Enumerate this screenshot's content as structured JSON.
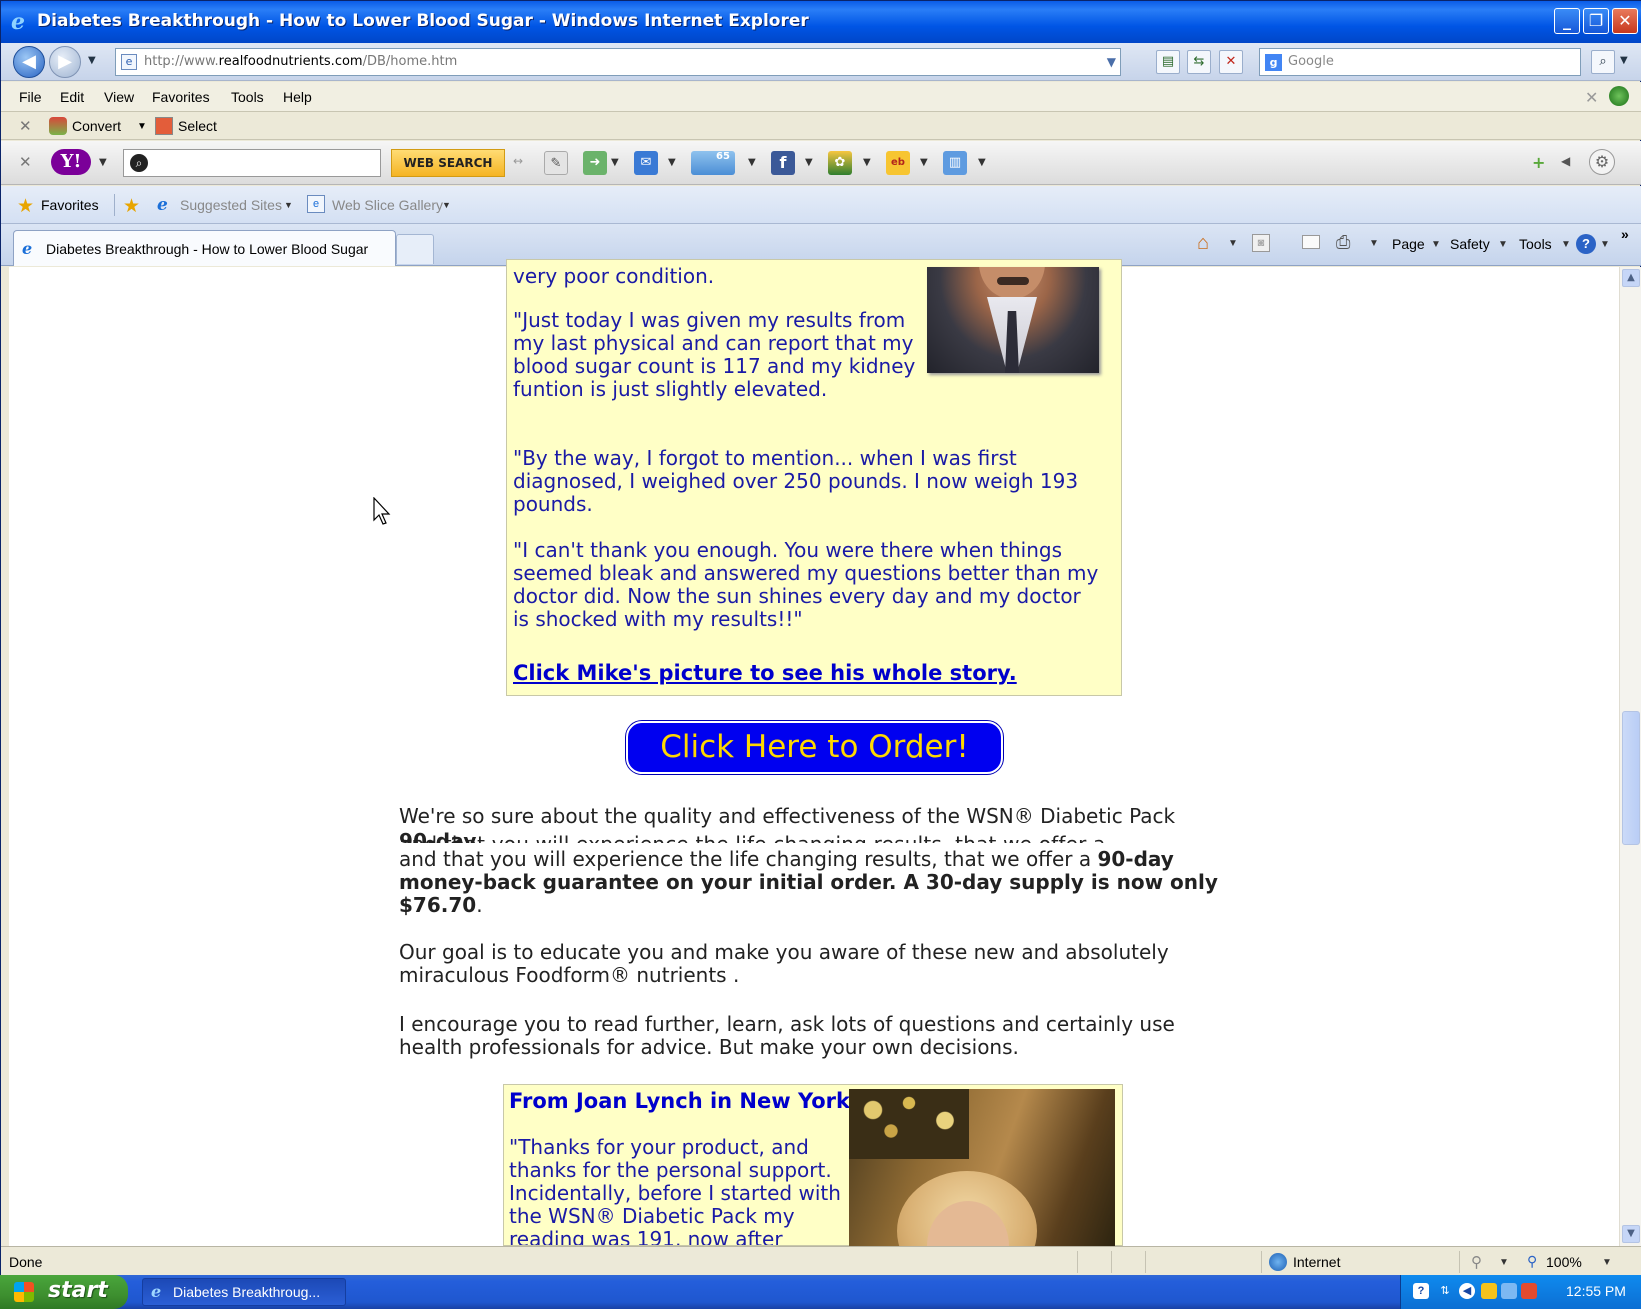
{
  "window": {
    "title": "Diabetes Breakthrough - How to Lower Blood Sugar - Windows Internet Explorer"
  },
  "address_bar": {
    "url_prefix": "http://www.",
    "url_host": "realfoodnutrients.com",
    "url_path": "/DB/home.htm",
    "search_placeholder": "Google"
  },
  "menu": {
    "items": [
      "File",
      "Edit",
      "View",
      "Favorites",
      "Tools",
      "Help"
    ]
  },
  "convert_toolbar": {
    "convert_label": "Convert",
    "select_label": "Select"
  },
  "yahoo_toolbar": {
    "web_search_label": "WEB SEARCH",
    "mail_count": "65"
  },
  "favorites_bar": {
    "favorites_label": "Favorites",
    "suggested_sites_label": "Suggested Sites",
    "web_slice_label": "Web Slice Gallery"
  },
  "tabs": {
    "active_tab_label": "Diabetes Breakthrough - How to Lower Blood Sugar"
  },
  "command_bar": {
    "page_label": "Page",
    "safety_label": "Safety",
    "tools_label": "Tools"
  },
  "content": {
    "mike_testimonial": {
      "line_top": "very poor condition.",
      "para1": "\"Just today I was given my results from my last physical and can report that my blood sugar count is 117 and my kidney funtion is just slightly elevated.",
      "para2": "\"By the way, I forgot to mention... when I was first diagnosed, I weighed over 250 pounds. I now weigh 193 pounds.",
      "para3": "\"I can't thank you enough. You were there when things seemed bleak and answered my questions better than my doctor did. Now the sun shines every day and my doctor is shocked with my results!!\"",
      "link": "Click Mike's picture to see his whole story."
    },
    "order_button": "Click Here to Order!",
    "guarantee_line1": "We're so sure about the quality and effectiveness of the WSN® Diabetic Pack",
    "guarantee_line2_normal": "and that you will experience the life changing results, that we offer a ",
    "guarantee_line2_bold": "90-day",
    "guarantee_bold_rest": "money-back guarantee on your initial order. A 30-day supply is now only $76.70",
    "guarantee_period": ".",
    "goal_text": "Our goal is to educate you and make you aware of these new and absolutely miraculous Foodform® nutrients .",
    "encourage_text": "I encourage you to read further, learn, ask lots of questions and certainly use health professionals for advice. But make your own decisions.",
    "joan_testimonial": {
      "heading": "From Joan Lynch in New York",
      "text": "\"Thanks for your product, and thanks for the personal support. Incidentally, before I started with the WSN® Diabetic Pack my reading was 191, now after"
    }
  },
  "status_bar": {
    "status": "Done",
    "zone": "Internet",
    "zoom": "100%"
  },
  "taskbar": {
    "start_label": "start",
    "task_label": "Diabetes Breakthroug...",
    "clock": "12:55 PM"
  }
}
